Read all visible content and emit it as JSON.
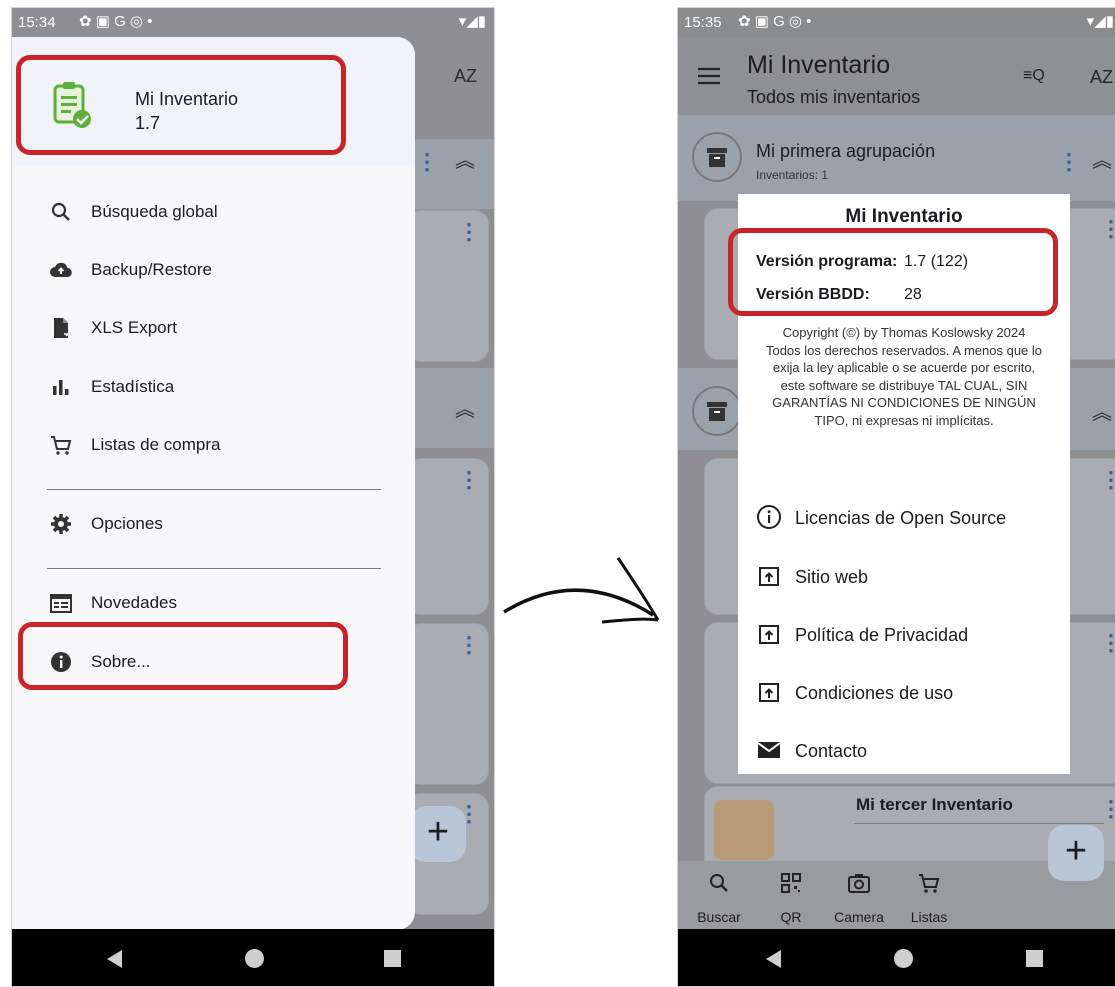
{
  "left_screen": {
    "status_time": "15:34",
    "toolbar_sort": "AZ",
    "drawer": {
      "app_name": "Mi Inventario",
      "app_version": "1.7",
      "items": [
        {
          "label": "Búsqueda global",
          "icon": "search-icon"
        },
        {
          "label": "Backup/Restore",
          "icon": "cloud-upload-icon"
        },
        {
          "label": "XLS Export",
          "icon": "file-export-icon"
        },
        {
          "label": "Estadística",
          "icon": "bar-chart-icon"
        },
        {
          "label": "Listas de compra",
          "icon": "shopping-cart-icon"
        },
        {
          "label": "Opciones",
          "icon": "gear-icon"
        },
        {
          "label": "Novedades",
          "icon": "calendar-icon"
        },
        {
          "label": "Sobre...",
          "icon": "info-icon"
        }
      ]
    },
    "fab_label": "+"
  },
  "right_screen": {
    "status_time": "15:35",
    "app_bar": {
      "title": "Mi Inventario",
      "subtitle": "Todos mis inventarios",
      "sort": "AZ"
    },
    "group": {
      "name": "Mi primera agrupación",
      "count_text": "Inventarios: 1"
    },
    "third_item": "Mi tercer Inventario",
    "dialog": {
      "title": "Mi Inventario",
      "version_program_label": "Versión programa:",
      "version_program_value": "1.7 (122)",
      "version_db_label": "Versión BBDD:",
      "version_db_value": "28",
      "copyright": "Copyright (©) by Thomas Koslowsky 2024 Todos los derechos reservados. A menos que lo exija la ley aplicable o se acuerde por escrito, este software se distribuye TAL CUAL, SIN GARANTÍAS NI CONDICIONES DE NINGÚN TIPO, ni expresas ni implícitas.",
      "links": [
        {
          "label": "Licencias de Open Source",
          "icon": "info-outline-icon"
        },
        {
          "label": "Sitio web",
          "icon": "open-external-icon"
        },
        {
          "label": "Política de Privacidad",
          "icon": "open-external-icon"
        },
        {
          "label": "Condiciones de uso",
          "icon": "open-external-icon"
        },
        {
          "label": "Contacto",
          "icon": "mail-icon"
        }
      ]
    },
    "bottom_nav": [
      {
        "label": "Buscar",
        "icon": "search-icon"
      },
      {
        "label": "QR",
        "icon": "qr-code-icon"
      },
      {
        "label": "Camera",
        "icon": "camera-icon"
      },
      {
        "label": "Listas",
        "icon": "shopping-cart-icon"
      }
    ],
    "fab_label": "+"
  },
  "colors": {
    "highlight": "#c8252b",
    "accent": "#2f5d95",
    "icon_green": "#5fad3b"
  }
}
